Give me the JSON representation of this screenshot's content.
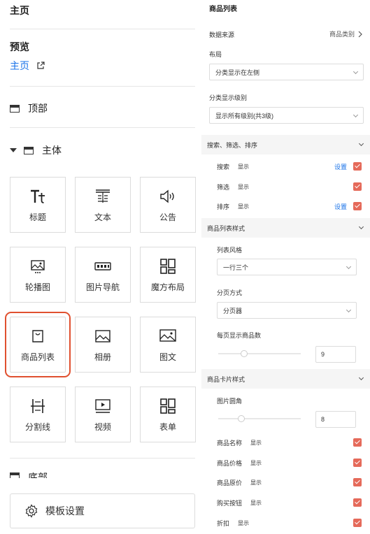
{
  "left": {
    "home_title": "主页",
    "preview_label": "预览",
    "home_link": "主页",
    "sections": {
      "top": "顶部",
      "body": "主体",
      "bottom": "底部"
    },
    "components": [
      {
        "label": "标题",
        "icon": "title-icon"
      },
      {
        "label": "文本",
        "icon": "text-icon"
      },
      {
        "label": "公告",
        "icon": "announcement-icon"
      },
      {
        "label": "轮播图",
        "icon": "carousel-icon"
      },
      {
        "label": "图片导航",
        "icon": "image-nav-icon"
      },
      {
        "label": "魔方布局",
        "icon": "cube-layout-icon"
      },
      {
        "label": "商品列表",
        "icon": "product-list-icon"
      },
      {
        "label": "相册",
        "icon": "album-icon"
      },
      {
        "label": "图文",
        "icon": "image-text-icon"
      },
      {
        "label": "分割线",
        "icon": "divider-icon"
      },
      {
        "label": "视频",
        "icon": "video-icon"
      },
      {
        "label": "表单",
        "icon": "form-icon"
      }
    ],
    "selected_component": "商品列表",
    "template_settings": "模板设置",
    "accent_color": "#1a73e8",
    "selection_color": "#e0502f"
  },
  "right": {
    "title": "商品列表",
    "data_source_label": "数据来源",
    "data_source_value": "商品类别",
    "layout_label": "布局",
    "layout_value": "分类显示在左侧",
    "category_level_label": "分类显示级别",
    "category_level_value": "显示所有级别(共3级)",
    "group_search": "搜索、筛选、排序",
    "search_rows": [
      {
        "label": "搜索",
        "show": "显示",
        "setting": "设置"
      },
      {
        "label": "筛选",
        "show": "显示",
        "setting": ""
      },
      {
        "label": "排序",
        "show": "显示",
        "setting": "设置"
      }
    ],
    "group_list_style": "商品列表样式",
    "list_style_label": "列表风格",
    "list_style_value": "一行三个",
    "paging_label": "分页方式",
    "paging_value": "分页器",
    "per_page_label": "每页显示商品数",
    "per_page_value": "9",
    "group_card_style": "商品卡片样式",
    "corner_label": "图片圆角",
    "corner_value": "8",
    "card_rows": [
      {
        "label": "商品名称",
        "show": "显示"
      },
      {
        "label": "商品价格",
        "show": "显示"
      },
      {
        "label": "商品原价",
        "show": "显示"
      },
      {
        "label": "购买按钮",
        "show": "显示"
      },
      {
        "label": "折扣",
        "show": "显示"
      }
    ],
    "checkbox_color": "#e56a5a"
  }
}
